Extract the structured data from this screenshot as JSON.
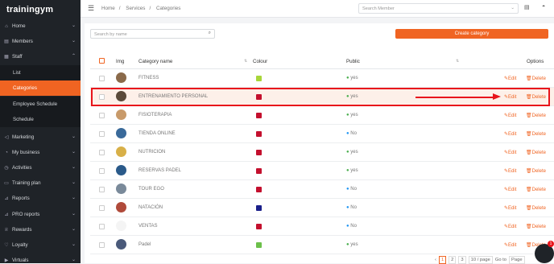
{
  "logo": "trainingym",
  "sidebar": {
    "items": [
      {
        "label": "Home"
      },
      {
        "label": "Members"
      },
      {
        "label": "Staff"
      },
      {
        "label": "List"
      },
      {
        "label": "Categories"
      },
      {
        "label": "Employee Schedule"
      },
      {
        "label": "Schedule"
      },
      {
        "label": "Marketing"
      },
      {
        "label": "My business"
      },
      {
        "label": "Activities"
      },
      {
        "label": "Training plan"
      },
      {
        "label": "Reports"
      },
      {
        "label": "PRO reports"
      },
      {
        "label": "Rewards"
      },
      {
        "label": "Loyalty"
      },
      {
        "label": "Virtuals"
      }
    ]
  },
  "breadcrumb": {
    "home": "Home",
    "services": "Services",
    "current": "Categories"
  },
  "top_search_placeholder": "Search Member",
  "search_placeholder": "Search by name",
  "create_button": "Create category",
  "table": {
    "headers": {
      "img": "Img",
      "name": "Category name",
      "colour": "Colour",
      "public": "Public",
      "options": "Options"
    },
    "edit_label": "Edit",
    "delete_label": "Delete",
    "rows": [
      {
        "name": "FITNESS",
        "colour": "#a8d63a",
        "public": "yes"
      },
      {
        "name": "ENTRENAMIENTO PERSONAL",
        "colour": "#c4102e",
        "public": "yes"
      },
      {
        "name": "FISIOTERAPIA",
        "colour": "#c4102e",
        "public": "yes"
      },
      {
        "name": "TIENDA ONLINE",
        "colour": "#c4102e",
        "public": "No"
      },
      {
        "name": "NUTRICION",
        "colour": "#c4102e",
        "public": "yes"
      },
      {
        "name": "RESERVAS PADEL",
        "colour": "#c4102e",
        "public": "yes"
      },
      {
        "name": "TOUR EGO",
        "colour": "#c4102e",
        "public": "No"
      },
      {
        "name": "NATACIÓN",
        "colour": "#1a1f8a",
        "public": "No"
      },
      {
        "name": "VENTAS",
        "colour": "#c4102e",
        "public": "No"
      },
      {
        "name": "Padel",
        "colour": "#6cc04a",
        "public": "yes"
      }
    ]
  },
  "pager": {
    "pages": [
      "1",
      "2",
      "3"
    ],
    "per_page": "10 / page",
    "goto": "Go to",
    "page_label": "Page"
  },
  "chat_badge": "1"
}
